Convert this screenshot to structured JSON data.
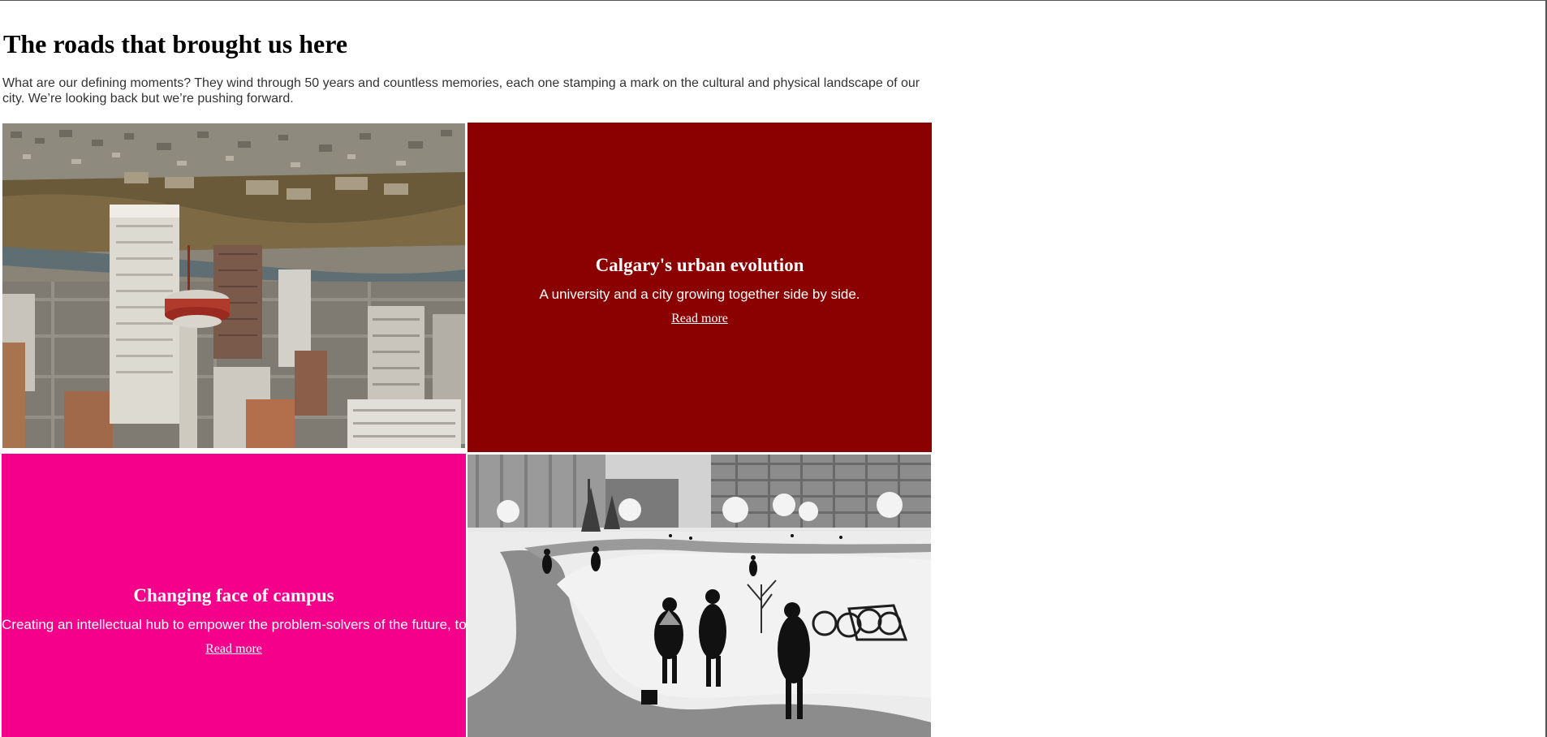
{
  "page": {
    "title": "The roads that brought us here",
    "intro": "What are our defining moments? They wind through 50 years and countless memories, each one stamping a mark on the cultural and physical landscape of our city. We’re looking back but we’re pushing forward."
  },
  "tiles": [
    {
      "kind": "photo",
      "icon": "aerial-city-photo",
      "description": ""
    },
    {
      "kind": "text",
      "background": "#8b0000",
      "heading": "Calgary's urban evolution",
      "text": "A university and a city growing together side by side.",
      "link": "Read more"
    },
    {
      "kind": "text",
      "background": "#f5008b",
      "heading": "Changing face of campus",
      "text": "Creating an intellectual hub to empower the problem-solvers of the future, today.",
      "link": "Read more"
    },
    {
      "kind": "photo",
      "icon": "winter-campus-photo",
      "description": ""
    }
  ]
}
